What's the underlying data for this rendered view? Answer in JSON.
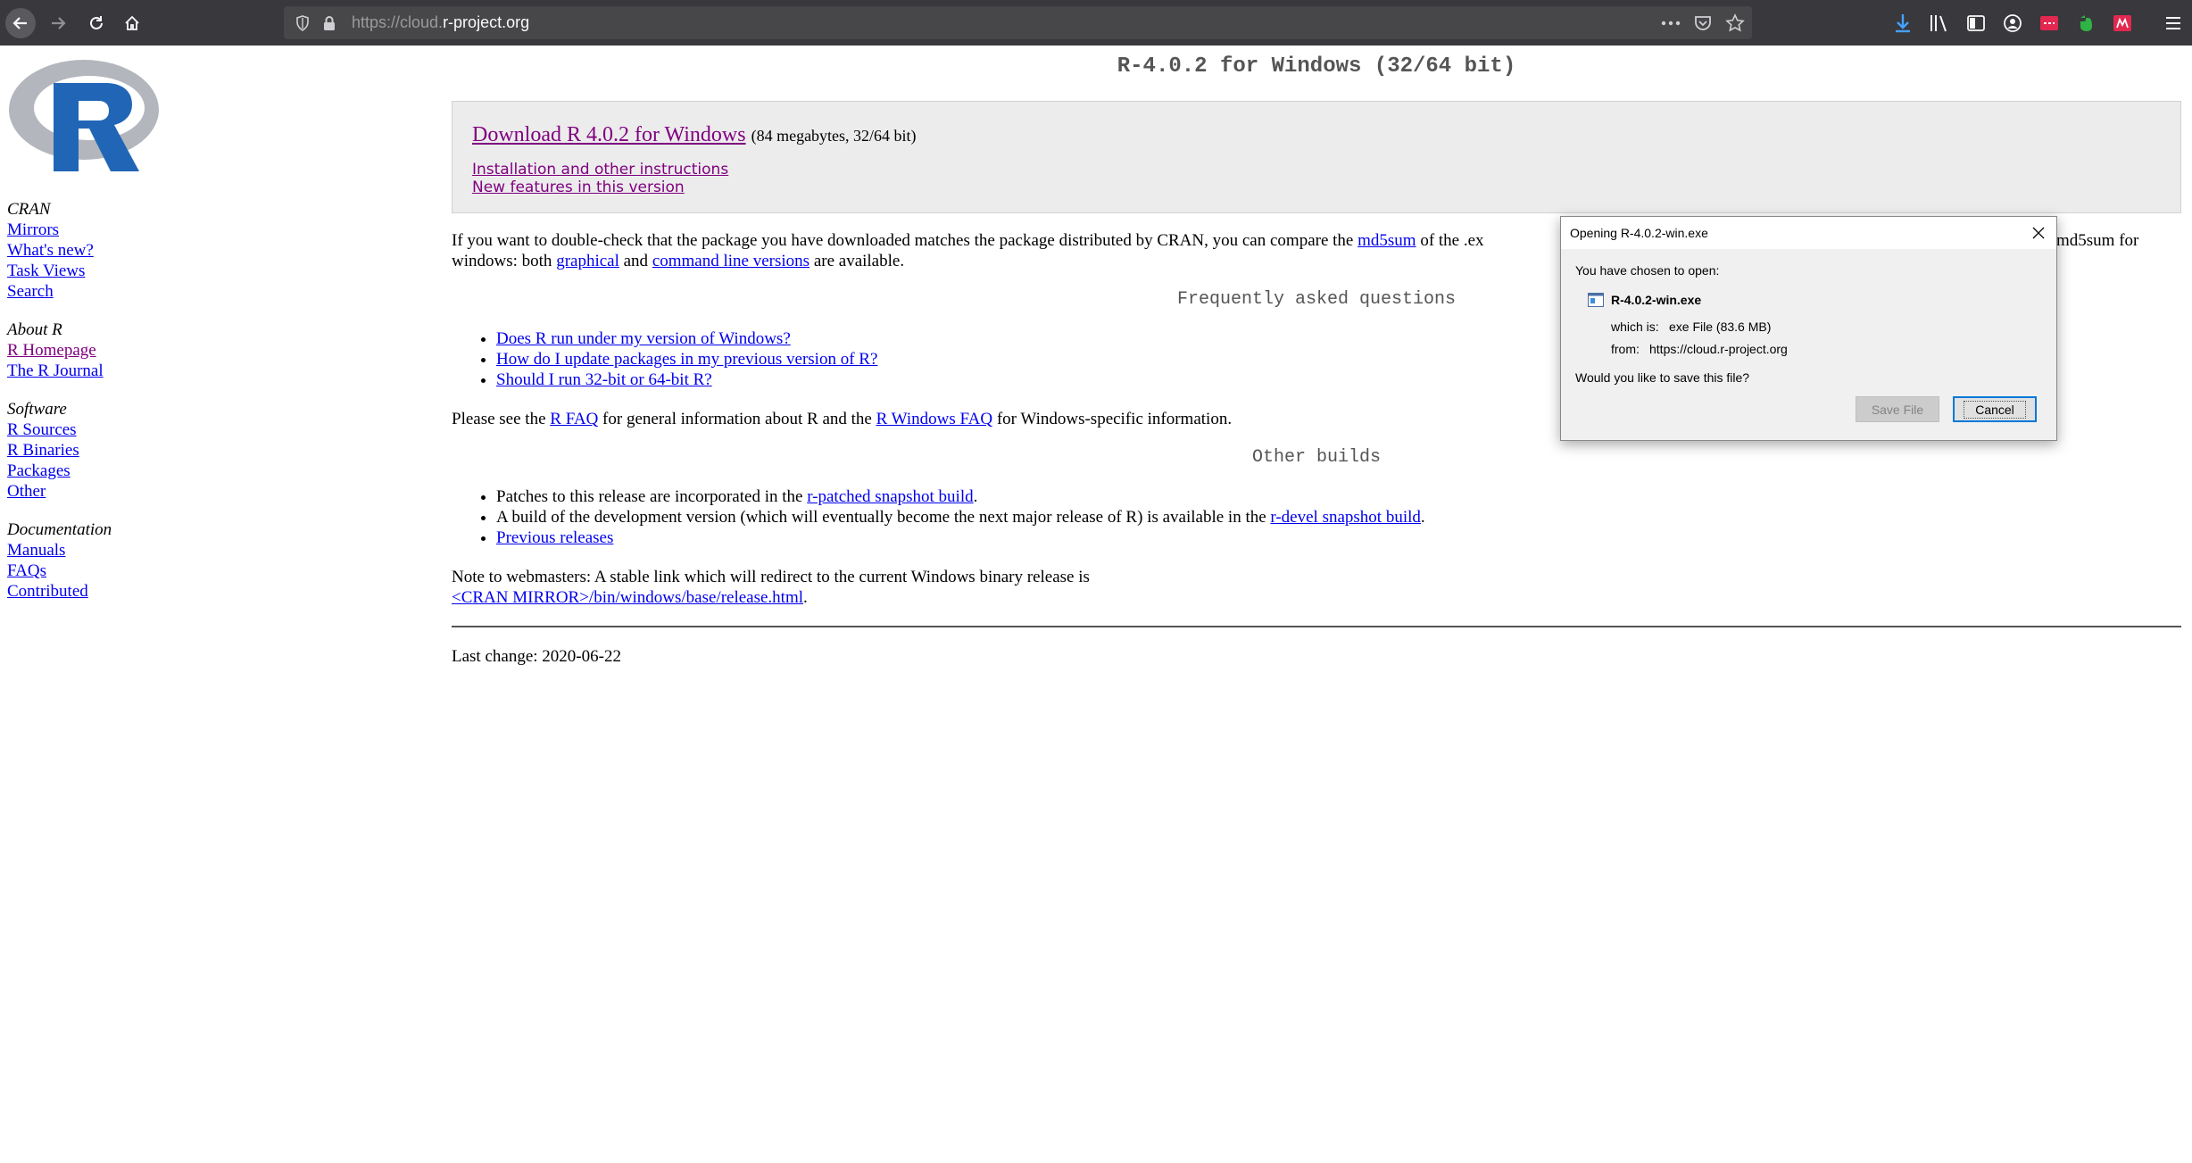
{
  "browser": {
    "url_prefix": "https://cloud.",
    "url_host": "r-project.org",
    "colors": {
      "toolbar": "#38383d",
      "urlbar": "#474749",
      "download_accent": "#45a1ff",
      "red_ext": "#e22850",
      "green_ext": "#2fb344"
    }
  },
  "logo": {
    "letter": "R"
  },
  "sidebar": {
    "groups": [
      {
        "heading": "CRAN",
        "links": [
          "Mirrors",
          "What's new?",
          "Task Views",
          "Search"
        ]
      },
      {
        "heading": "About R",
        "links": [
          "R Homepage",
          "The R Journal"
        ]
      },
      {
        "heading": "Software",
        "links": [
          "R Sources",
          "R Binaries",
          "Packages",
          "Other"
        ]
      },
      {
        "heading": "Documentation",
        "links": [
          "Manuals",
          "FAQs",
          "Contributed"
        ]
      }
    ]
  },
  "main": {
    "title": "R-4.0.2 for Windows (32/64 bit)",
    "download": {
      "link": "Download R 4.0.2 for Windows",
      "size_note": "(84 megabytes, 32/64 bit)",
      "install_link": "Installation and other instructions",
      "features_link": "New features in this version"
    },
    "md5_para": {
      "t1": "If you want to double-check that the package you have downloaded matches the package distributed by CRAN, you can compare the ",
      "link1": "md5sum",
      "t2": " of the .ex",
      "t3": "md5sum for",
      "t4": "windows: both ",
      "link2": "graphical",
      "t5": " and ",
      "link3": "command line versions",
      "t6": " are available."
    },
    "faq_heading": "Frequently asked questions",
    "faq_items": [
      "Does R run under my version of Windows?",
      "How do I update packages in my previous version of R?",
      "Should I run 32-bit or 64-bit R?"
    ],
    "faq_para": {
      "t1": "Please see the ",
      "link1": "R FAQ",
      "t2": " for general information about R and the ",
      "link2": "R Windows FAQ",
      "t3": " for Windows-specific information."
    },
    "other_heading": "Other builds",
    "other_items": {
      "i1_text": "Patches to this release are incorporated in the ",
      "i1_link": "r-patched snapshot build",
      "i1_end": ".",
      "i2_text": "A build of the development version (which will eventually become the next major release of R) is available in the ",
      "i2_link": "r-devel snapshot build",
      "i2_end": ".",
      "i3_link": "Previous releases"
    },
    "webmaster": {
      "line1": "Note to webmasters: A stable link which will redirect to the current Windows binary release is",
      "link": "<CRAN MIRROR>/bin/windows/base/release.html",
      "end": "."
    },
    "last_change": "Last change: 2020-06-22"
  },
  "dialog": {
    "title": "Opening R-4.0.2-win.exe",
    "chosen": "You have chosen to open:",
    "filename": "R-4.0.2-win.exe",
    "which_label": "which is:",
    "which_value": "exe File (83.6 MB)",
    "from_label": "from:",
    "from_value": "https://cloud.r-project.org",
    "question": "Would you like to save this file?",
    "save_button": "Save File",
    "cancel_button": "Cancel"
  }
}
